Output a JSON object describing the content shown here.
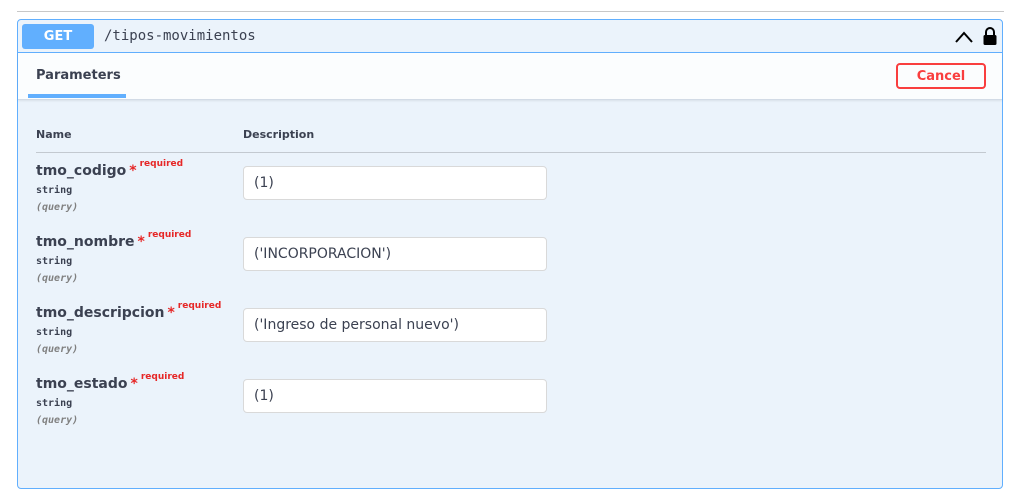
{
  "operation": {
    "method": "GET",
    "path": "/tipos-movimientos"
  },
  "tabs": {
    "parameters_label": "Parameters",
    "cancel_label": "Cancel"
  },
  "columns": {
    "name": "Name",
    "description": "Description"
  },
  "params": [
    {
      "name": "tmo_codigo",
      "required_star": "*",
      "required_text": "required",
      "type": "string",
      "in": "(query)",
      "value": "(1)"
    },
    {
      "name": "tmo_nombre",
      "required_star": "*",
      "required_text": "required",
      "type": "string",
      "in": "(query)",
      "value": "('INCORPORACION')"
    },
    {
      "name": "tmo_descripcion",
      "required_star": "*",
      "required_text": "required",
      "type": "string",
      "in": "(query)",
      "value": "('Ingreso de personal nuevo')"
    },
    {
      "name": "tmo_estado",
      "required_star": "*",
      "required_text": "required",
      "type": "string",
      "in": "(query)",
      "value": "(1)"
    }
  ],
  "icons": {
    "collapse": "chevron-up-icon",
    "auth": "lock-icon"
  },
  "colors": {
    "get_accent": "#61affe",
    "required": "#e62727",
    "cancel": "#f93e3e"
  }
}
